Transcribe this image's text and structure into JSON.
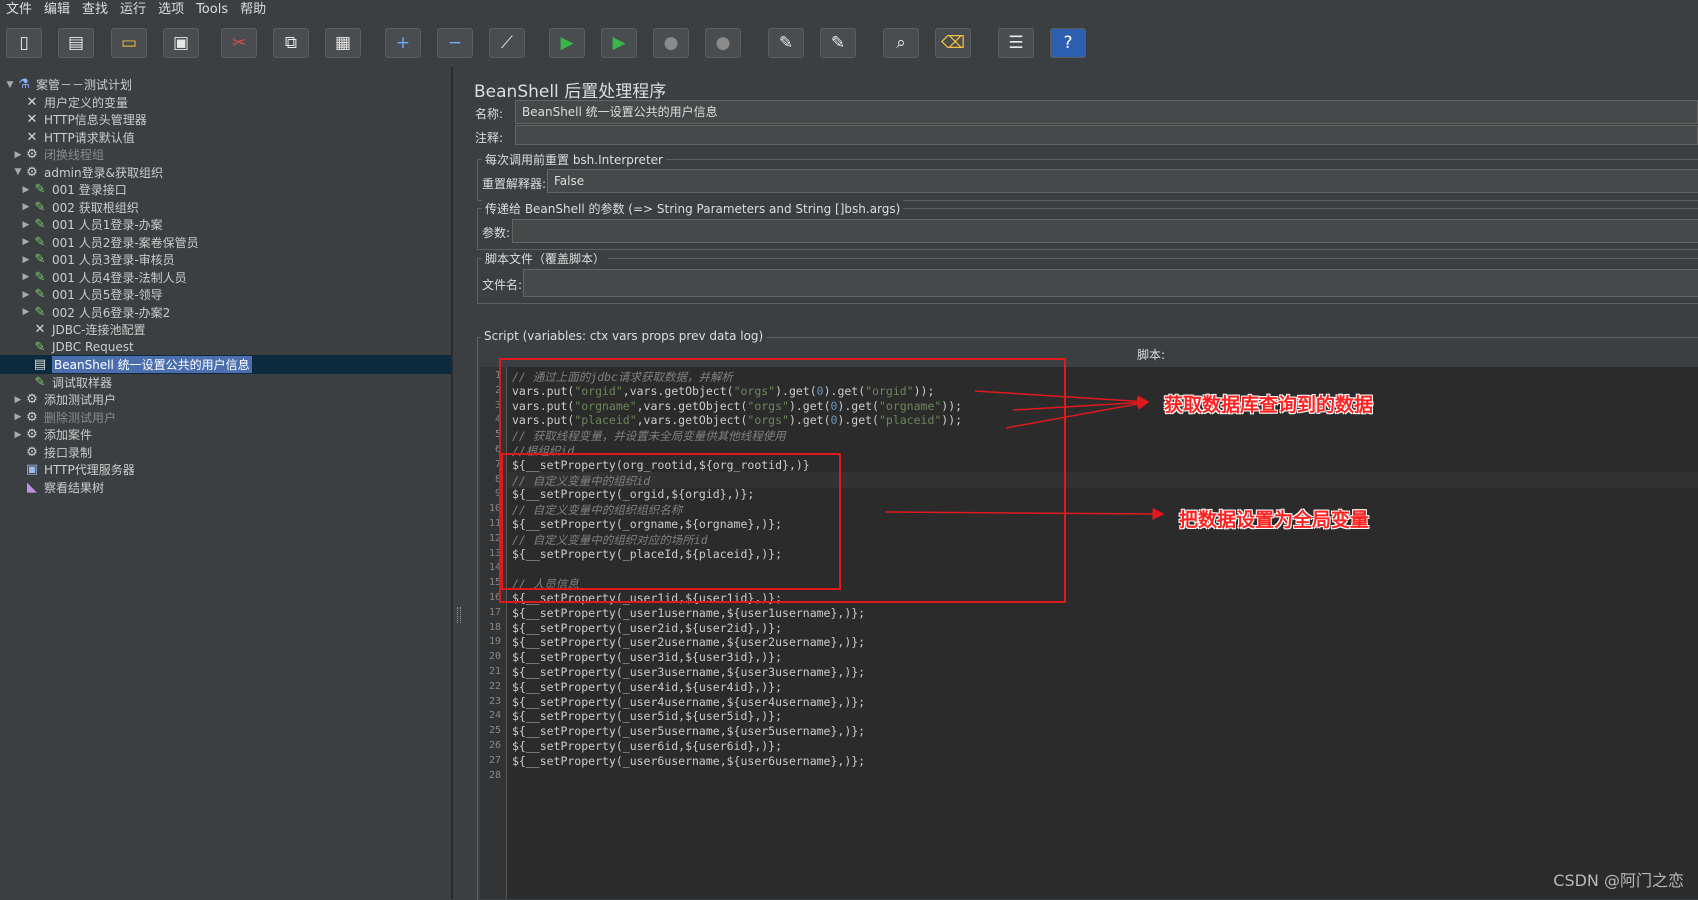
{
  "menu": [
    "文件",
    "编辑",
    "查找",
    "运行",
    "选项",
    "Tools",
    "帮助"
  ],
  "toolbar_icons": [
    "new-icon",
    "templates-icon",
    "open-icon",
    "save-icon",
    "cut-icon",
    "copy-icon",
    "paste-icon",
    "expand-icon",
    "collapse-icon",
    "toggle-icon",
    "start-icon",
    "start-no-pause-icon",
    "stop-icon",
    "shutdown-icon",
    "clear-icon",
    "clear-all-icon",
    "search-icon",
    "reset-search-icon",
    "function-helper-icon",
    "help-icon"
  ],
  "tree": [
    {
      "label": "案管－－测试计划",
      "depth": 0,
      "expand": "open",
      "icon": "flask-icon"
    },
    {
      "label": "用户定义的变量",
      "depth": 1,
      "expand": "",
      "icon": "wrench-icon"
    },
    {
      "label": "HTTP信息头管理器",
      "depth": 1,
      "expand": "",
      "icon": "wrench-icon"
    },
    {
      "label": "HTTP请求默认值",
      "depth": 1,
      "expand": "",
      "icon": "wrench-icon"
    },
    {
      "label": "闭换线程组",
      "depth": 1,
      "expand": "closed",
      "icon": "gear-icon",
      "dim": true
    },
    {
      "label": "admin登录&获取组织",
      "depth": 1,
      "expand": "open",
      "icon": "gear-icon"
    },
    {
      "label": "001 登录接口",
      "depth": 2,
      "expand": "closed",
      "icon": "sampler-icon"
    },
    {
      "label": "002 获取根组织",
      "depth": 2,
      "expand": "closed",
      "icon": "sampler-icon"
    },
    {
      "label": "001 人员1登录-办案",
      "depth": 2,
      "expand": "closed",
      "icon": "sampler-icon"
    },
    {
      "label": "001 人员2登录-案卷保管员",
      "depth": 2,
      "expand": "closed",
      "icon": "sampler-icon"
    },
    {
      "label": "001 人员3登录-审核员",
      "depth": 2,
      "expand": "closed",
      "icon": "sampler-icon"
    },
    {
      "label": "001 人员4登录-法制人员",
      "depth": 2,
      "expand": "closed",
      "icon": "sampler-icon"
    },
    {
      "label": "001 人员5登录-领导",
      "depth": 2,
      "expand": "closed",
      "icon": "sampler-icon"
    },
    {
      "label": "002 人员6登录-办案2",
      "depth": 2,
      "expand": "closed",
      "icon": "sampler-icon"
    },
    {
      "label": "JDBC-连接池配置",
      "depth": 2,
      "expand": "",
      "icon": "wrench-icon"
    },
    {
      "label": "JDBC Request",
      "depth": 2,
      "expand": "",
      "icon": "sampler-icon"
    },
    {
      "label": "BeanShell 统一设置公共的用户信息",
      "depth": 2,
      "expand": "",
      "icon": "script-icon",
      "selected": true
    },
    {
      "label": "调试取样器",
      "depth": 2,
      "expand": "",
      "icon": "sampler-icon"
    },
    {
      "label": "添加测试用户",
      "depth": 1,
      "expand": "closed",
      "icon": "gear-icon"
    },
    {
      "label": "删除测试用户",
      "depth": 1,
      "expand": "closed",
      "icon": "gear-icon",
      "dim": true
    },
    {
      "label": "添加案件",
      "depth": 1,
      "expand": "closed",
      "icon": "gear-icon"
    },
    {
      "label": "接口录制",
      "depth": 1,
      "expand": "",
      "icon": "gear-icon"
    },
    {
      "label": "HTTP代理服务器",
      "depth": 1,
      "expand": "",
      "icon": "proxy-icon"
    },
    {
      "label": "察看结果树",
      "depth": 1,
      "expand": "",
      "icon": "listener-icon"
    }
  ],
  "panel": {
    "title": "BeanShell 后置处理程序",
    "name_label": "名称:",
    "name_value": "BeanShell 统一设置公共的用户信息",
    "comment_label": "注释:",
    "comment_value": "",
    "reset_legend": "每次调用前重置 bsh.Interpreter",
    "reset_label": "重置解释器:",
    "reset_value": "False",
    "params_legend": "传递给 BeanShell 的参数 (=> String Parameters and String []bsh.args)",
    "params_label": "参数:",
    "params_value": "",
    "file_legend": "脚本文件（覆盖脚本）",
    "file_label": "文件名:",
    "file_value": "",
    "script_legend": "Script (variables: ctx vars props prev data log)",
    "script_label": "脚本:"
  },
  "script_lines": [
    "// 通过上面的jdbc请求获取数据，并解析",
    "vars.put(\"orgid\",vars.getObject(\"orgs\").get(0).get(\"orgid\"));",
    "vars.put(\"orgname\",vars.getObject(\"orgs\").get(0).get(\"orgname\"));",
    "vars.put(\"placeid\",vars.getObject(\"orgs\").get(0).get(\"placeid\"));",
    "// 获取线程变量，并设置未全局变量供其他线程使用",
    "//根组织id",
    "${__setProperty(org_rootid,${org_rootid},)}",
    "// 自定义变量中的组织id",
    "${__setProperty(_orgid,${orgid},)};",
    "// 自定义变量中的组织组织名称",
    "${__setProperty(_orgname,${orgname},)};",
    "// 自定义变量中的组织对应的场所id",
    "${__setProperty(_placeId,${placeid},)};",
    "",
    "// 人员信息",
    "${__setProperty(_user1id,${user1id},)};",
    "${__setProperty(_user1username,${user1username},)};",
    "${__setProperty(_user2id,${user2id},)};",
    "${__setProperty(_user2username,${user2username},)};",
    "${__setProperty(_user3id,${user3id},)};",
    "${__setProperty(_user3username,${user3username},)};",
    "${__setProperty(_user4id,${user4id},)};",
    "${__setProperty(_user4username,${user4username},)};",
    "${__setProperty(_user5id,${user5id},)};",
    "${__setProperty(_user5username,${user5username},)};",
    "${__setProperty(_user6id,${user6id},)};",
    "${__setProperty(_user6username,${user6username},)};",
    ""
  ],
  "annotations": {
    "label1": "获取数据库查询到的数据",
    "label2": "把数据设置为全局变量"
  },
  "watermark": "CSDN @阿门之恋",
  "colors": {
    "accent_red": "#e0191f",
    "selection": "#4b6eaf"
  }
}
